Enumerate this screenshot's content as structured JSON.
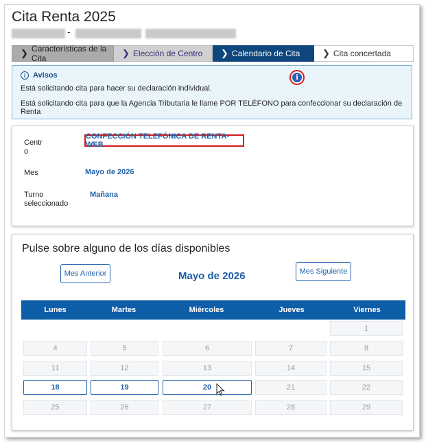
{
  "page": {
    "title": "Cita Renta 2025",
    "separator": "-"
  },
  "steps": [
    {
      "label": "Características de la Cita",
      "state": "completed"
    },
    {
      "label": "Elección de Centro",
      "state": "completed"
    },
    {
      "label": "Calendario de Cita",
      "state": "active"
    },
    {
      "label": "Cita concertada",
      "state": "pending"
    }
  ],
  "avisos": {
    "title": "Avisos",
    "line1": "Está solicitando cita para hacer su declaración individual.",
    "line2": "Está solicitando cita para que la Agencia Tributaria le llame POR TELÉFONO para confeccionar su declaración de Renta",
    "info_glyph": "i"
  },
  "summary": {
    "centro_label_1": "Centr",
    "centro_label_2": "o",
    "centro_value": "CONFECCIÓN TELEFÓNICA DE RENTA-WEB",
    "mes_label": "Mes",
    "mes_value": "Mayo de 2026",
    "turno_label_1": "Turno",
    "turno_label_2": "seleccionado",
    "turno_value": "Mañana"
  },
  "calendar": {
    "instruction": "Pulse sobre alguno de los días disponibles",
    "prev_label": "Mes Anterior",
    "next_label": "Mes Siguiente",
    "month_title": "Mayo de 2026",
    "weekdays": [
      "Lunes",
      "Martes",
      "Miércoles",
      "Jueves",
      "Viernes"
    ],
    "rows": [
      [
        "",
        "",
        "",
        "",
        "1"
      ],
      [
        "4",
        "5",
        "6",
        "7",
        "8"
      ],
      [
        "11",
        "12",
        "13",
        "14",
        "15"
      ],
      [
        "18",
        "19",
        "20",
        "21",
        "22"
      ],
      [
        "25",
        "26",
        "27",
        "28",
        "29"
      ]
    ],
    "available_days": [
      "18",
      "19",
      "20"
    ]
  },
  "colors": {
    "accent": "#0e5da7",
    "active_step": "#0e467d",
    "highlight": "#d01a1a",
    "link": "#1f5fa8"
  }
}
